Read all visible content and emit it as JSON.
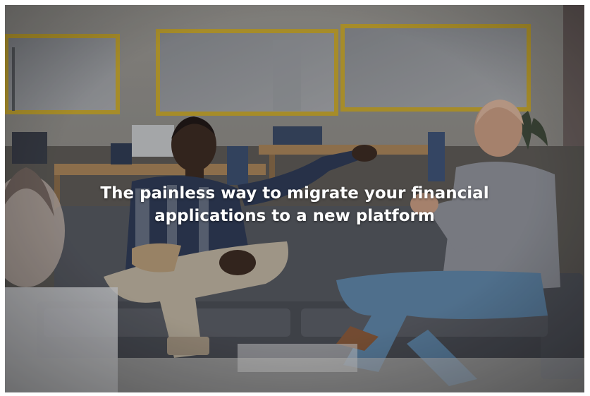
{
  "hero": {
    "headline_line1": "The painless way to migrate your financial",
    "headline_line2": "applications to a new platform",
    "image_subject": "two-men-conversing-on-sofa-photo"
  },
  "colors": {
    "headline_text": "#ffffff",
    "frame_accent": "#c9a92f",
    "sofa": "#4a4d54"
  }
}
